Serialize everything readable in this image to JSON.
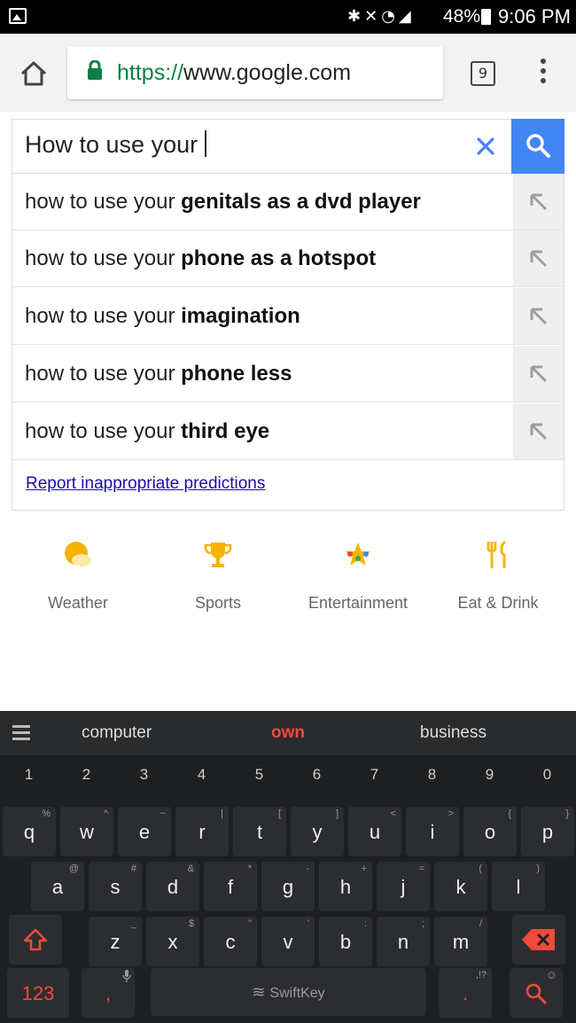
{
  "status_bar": {
    "icons": [
      "gallery-icon",
      "bluetooth-icon",
      "mute-icon",
      "wifi-icon",
      "signal-icon",
      "battery-icon"
    ],
    "battery": "48%",
    "time": "9:06 PM"
  },
  "browser": {
    "url_scheme": "https://",
    "url_host": "www.google.com",
    "tab_count": "9",
    "lock_color": "#0b8043"
  },
  "search": {
    "query": "How to use your",
    "button_color": "#4285f4"
  },
  "suggestions": [
    {
      "prefix": "how to use your ",
      "completion": "genitals as a dvd player"
    },
    {
      "prefix": "how to use your ",
      "completion": "phone as a hotspot"
    },
    {
      "prefix": "how to use your ",
      "completion": "imagination"
    },
    {
      "prefix": "how to use your ",
      "completion": "phone less"
    },
    {
      "prefix": "how to use your ",
      "completion": "third eye"
    }
  ],
  "report_link": "Report inappropriate predictions",
  "tiles": [
    {
      "label": "Weather",
      "icon": "weather-icon"
    },
    {
      "label": "Sports",
      "icon": "trophy-icon"
    },
    {
      "label": "Entertainment",
      "icon": "star-icon"
    },
    {
      "label": "Eat & Drink",
      "icon": "fork-knife-icon"
    }
  ],
  "keyboard": {
    "predictions": [
      "computer",
      "own",
      "business"
    ],
    "numbers": [
      "1",
      "2",
      "3",
      "4",
      "5",
      "6",
      "7",
      "8",
      "9",
      "0"
    ],
    "row1": [
      {
        "k": "q",
        "a": "%"
      },
      {
        "k": "w",
        "a": "^"
      },
      {
        "k": "e",
        "a": "~"
      },
      {
        "k": "r",
        "a": "|"
      },
      {
        "k": "t",
        "a": "["
      },
      {
        "k": "y",
        "a": "]"
      },
      {
        "k": "u",
        "a": "<"
      },
      {
        "k": "i",
        "a": ">"
      },
      {
        "k": "o",
        "a": "{"
      },
      {
        "k": "p",
        "a": "}"
      }
    ],
    "row2": [
      {
        "k": "a",
        "a": "@"
      },
      {
        "k": "s",
        "a": "#"
      },
      {
        "k": "d",
        "a": "&"
      },
      {
        "k": "f",
        "a": "*"
      },
      {
        "k": "g",
        "a": "-"
      },
      {
        "k": "h",
        "a": "+"
      },
      {
        "k": "j",
        "a": "="
      },
      {
        "k": "k",
        "a": "("
      },
      {
        "k": "l",
        "a": ")"
      }
    ],
    "row3": [
      {
        "k": "z",
        "a": "_"
      },
      {
        "k": "x",
        "a": "$"
      },
      {
        "k": "c",
        "a": "\""
      },
      {
        "k": "v",
        "a": "'"
      },
      {
        "k": "b",
        "a": ":"
      },
      {
        "k": "n",
        "a": ";"
      },
      {
        "k": "m",
        "a": "/"
      }
    ],
    "numbers_key": "123",
    "comma_key": ",",
    "period_key": ".",
    "period_alt": ",!?",
    "space_brand": "SwiftKey",
    "accent_color": "#f24a3c"
  }
}
